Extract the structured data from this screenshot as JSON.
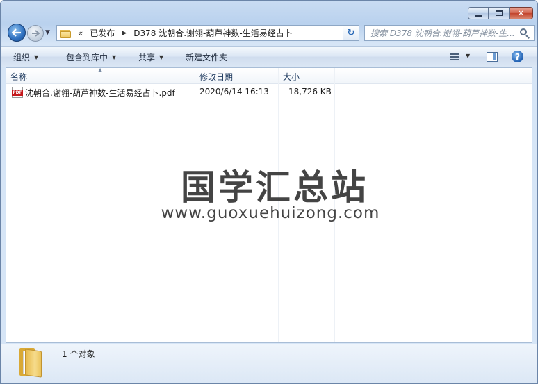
{
  "window": {
    "controls": {
      "minimize": "minimize",
      "maximize": "maximize",
      "close": "✕"
    }
  },
  "nav": {
    "back_icon": "back-arrow-icon",
    "forward_icon": "forward-arrow-icon",
    "address": {
      "overflow": "«",
      "crumbs": [
        "已发布",
        "D378 沈朝合.谢翎-葫芦神数-生活易经占卜"
      ]
    },
    "search_placeholder": "搜索 D378 沈朝合.谢翎-葫芦神数-生..."
  },
  "toolbar": {
    "organize": "组织",
    "include_in_library": "包含到库中",
    "share": "共享",
    "new_folder": "新建文件夹"
  },
  "columns": {
    "name": "名称",
    "modified": "修改日期",
    "size": "大小"
  },
  "files": [
    {
      "icon": "pdf-icon",
      "icon_text": "PDF",
      "name": "沈朝合.谢翎-葫芦神数-生活易经占卜.pdf",
      "modified": "2020/6/14 16:13",
      "size": "18,726 KB"
    }
  ],
  "watermark": {
    "title": "国学汇总站",
    "url": "www.guoxuehuizong.com"
  },
  "status": {
    "count": "1 个对象"
  },
  "colors": {
    "accent": "#2d6fbf",
    "close": "#c2432c",
    "pdf": "#c4191c"
  }
}
